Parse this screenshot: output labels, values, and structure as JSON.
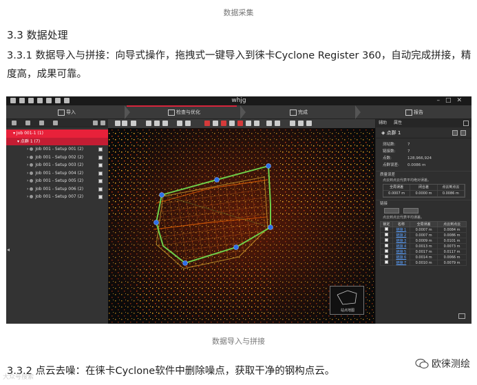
{
  "captions": {
    "top": "数据采集",
    "middle": "数据导入与拼接"
  },
  "section": {
    "h3": "3.3 数据处理",
    "p331": "3.3.1 数据导入与拼接：向导式操作，拖拽式一键导入到徕卡Cyclone Register 360，自动完成拼接，精度高，成果可靠。",
    "h332": "3.3.2 点云去噪：在徕卡Cyclone软件中删除噪点，获取干净的钢构点云。"
  },
  "screenshot": {
    "window_title": "whjg",
    "steps": [
      "导入",
      "检查与优化",
      "完成",
      "报告"
    ],
    "tree": {
      "root": "Job 001-1 (1)",
      "bundle": "点群 1 (7)",
      "setups": [
        "Job 001 - Setup 001 (2)",
        "Job 001 - Setup 002 (2)",
        "Job 001 - Setup 003 (2)",
        "Job 001 - Setup 004 (2)",
        "Job 001 - Setup 005 (2)",
        "Job 001 - Setup 006 (2)",
        "Job 001 - Setup 007 (2)"
      ]
    },
    "minimap_label": "站点地图",
    "right_panel": {
      "tabs": [
        "辅助",
        "属性"
      ],
      "header": "点群 1",
      "props": [
        {
          "k": "测站数:",
          "v": "7"
        },
        {
          "k": "链接数:",
          "v": "7"
        },
        {
          "k": "点数:",
          "v": "128,966,924"
        },
        {
          "k": "点群误差:",
          "v": "0.0086 m"
        }
      ],
      "quality_title": "质量误差",
      "quality_sub": "点云到点云代表平均绝对误差。",
      "quality_headers": [
        "全局误差",
        "闭合差",
        "点云到点云"
      ],
      "quality_values": [
        "0.0007 m",
        "0.0000 m",
        "0.0086 m"
      ],
      "links_title": "链接",
      "links_sub": "点云到点云代表平均误差。",
      "table_headers": [
        "锁定",
        "名称",
        "全局误差",
        "点云到点云"
      ],
      "rows": [
        {
          "name": "链接 1",
          "err": "0.0007 m",
          "c2c": "0.0084 m"
        },
        {
          "name": "链接 2",
          "err": "0.0007 m",
          "c2c": "0.0086 m"
        },
        {
          "name": "链接 3",
          "err": "0.0009 m",
          "c2c": "0.0101 m"
        },
        {
          "name": "链接 4",
          "err": "0.0013 m",
          "c2c": "0.0073 m"
        },
        {
          "name": "链接 5",
          "err": "0.0017 m",
          "c2c": "0.0117 m"
        },
        {
          "name": "链接 6",
          "err": "0.0014 m",
          "c2c": "0.0066 m"
        },
        {
          "name": "链接 7",
          "err": "0.0010 m",
          "c2c": "0.0079 m"
        }
      ]
    }
  },
  "watermark": {
    "brand": "欧徕测绘",
    "left": "大众号搜索"
  },
  "colors": {
    "accent_red": "#e8213a",
    "link_green": "#6fcf4a",
    "node_blue": "#2e6fe8"
  }
}
